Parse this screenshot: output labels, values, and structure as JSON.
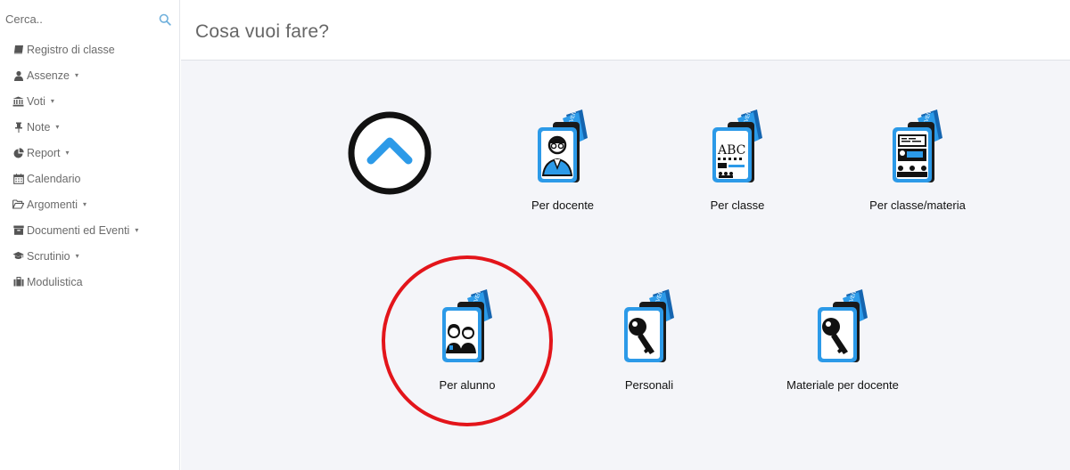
{
  "sidebar": {
    "search_placeholder": "Cerca..",
    "items": [
      {
        "label": "Registro di classe",
        "icon": "book-icon",
        "has_caret": false
      },
      {
        "label": "Assenze",
        "icon": "user-icon",
        "has_caret": true
      },
      {
        "label": "Voti",
        "icon": "institution-icon",
        "has_caret": true
      },
      {
        "label": "Note",
        "icon": "pushpin-icon",
        "has_caret": true
      },
      {
        "label": "Report",
        "icon": "pie-chart-icon",
        "has_caret": true
      },
      {
        "label": "Calendario",
        "icon": "calendar-icon",
        "has_caret": false
      },
      {
        "label": "Argomenti",
        "icon": "folder-open-icon",
        "has_caret": true
      },
      {
        "label": "Documenti ed Eventi",
        "icon": "archive-icon",
        "has_caret": true
      },
      {
        "label": "Scrutinio",
        "icon": "graduation-cap-icon",
        "has_caret": true
      },
      {
        "label": "Modulistica",
        "icon": "briefcase-icon",
        "has_caret": false
      }
    ],
    "caret": "▾"
  },
  "header": {
    "title": "Cosa vuoi fare?"
  },
  "tiles": [
    {
      "label": "Per docente",
      "icon": "teacher-icon"
    },
    {
      "label": "Per classe",
      "icon": "abc-class-icon"
    },
    {
      "label": "Per classe/materia",
      "icon": "classroom-subject-icon"
    },
    {
      "label": "Per alunno",
      "icon": "students-icon"
    },
    {
      "label": "Personali",
      "icon": "key-icon"
    },
    {
      "label": "Materiale per docente",
      "icon": "key-icon"
    }
  ],
  "tile_badge_text": "EVEN",
  "colors": {
    "accent_blue": "#2c9ae8",
    "highlight_red": "#e3151b",
    "sidebar_text": "#6b6b6b",
    "main_bg": "#f4f5f9"
  }
}
